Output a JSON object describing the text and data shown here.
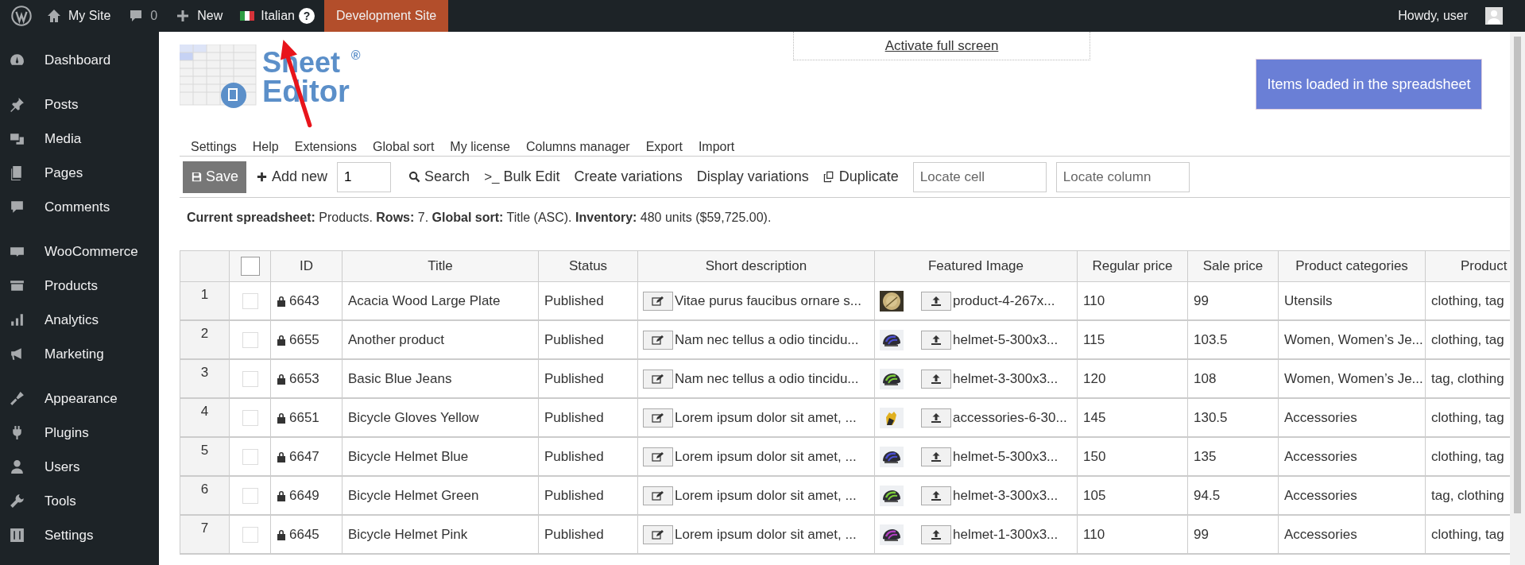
{
  "admin_bar": {
    "site": "My Site",
    "comments": "0",
    "new": "New",
    "language": "Italian",
    "help": "?",
    "environment": "Development Site",
    "greeting": "Howdy, user"
  },
  "sidebar": {
    "groups": [
      [
        {
          "label": "Dashboard"
        }
      ],
      [
        {
          "label": "Posts"
        },
        {
          "label": "Media"
        },
        {
          "label": "Pages"
        },
        {
          "label": "Comments"
        }
      ],
      [
        {
          "label": "WooCommerce"
        },
        {
          "label": "Products"
        },
        {
          "label": "Analytics"
        },
        {
          "label": "Marketing"
        }
      ],
      [
        {
          "label": "Appearance"
        },
        {
          "label": "Plugins"
        },
        {
          "label": "Users"
        },
        {
          "label": "Tools"
        },
        {
          "label": "Settings"
        }
      ]
    ]
  },
  "logo": {
    "word_1": "Sheet",
    "word_2": "Editor",
    "mark": "®"
  },
  "fullscreen_link": "Activate full screen",
  "items_button": "Items loaded in the spreadsheet",
  "menu": [
    "Settings",
    "Help",
    "Extensions",
    "Global sort",
    "My license",
    "Columns manager",
    "Export",
    "Import"
  ],
  "toolbar": {
    "save": "Save",
    "add_new": "Add new",
    "add_count": "1",
    "search": "Search",
    "bulk_edit_icon": ">_",
    "bulk_edit": "Bulk Edit",
    "create_variations": "Create variations",
    "display_variations": "Display variations",
    "duplicate": "Duplicate",
    "locate_cell": {
      "placeholder": "Locate cell"
    },
    "locate_column": {
      "placeholder": "Locate column"
    }
  },
  "summary": "**Current spreadsheet:** Products. **Rows:** 7. **Global sort:** Title (ASC). **Inventory:** 480 units ($59,725.00).",
  "table": {
    "select_all_checked": false,
    "columns": [
      "ID",
      "Title",
      "Status",
      "Short description",
      "Featured Image",
      "Regular price",
      "Sale price",
      "Product categories",
      "Product"
    ],
    "rows": [
      {
        "number": "1",
        "checked": false,
        "locked": true,
        "id": "6643",
        "title": "Acacia Wood Large Plate",
        "status": "Published",
        "short_description": "Vitae purus faucibus ornare s...",
        "file": "product-4-267x...",
        "regular_price": "110",
        "sale_price": "99",
        "categories": "Utensils",
        "product": "clothing, tag"
      },
      {
        "number": "2",
        "checked": false,
        "locked": true,
        "id": "6655",
        "title": "Another product",
        "status": "Published",
        "short_description": "Nam nec tellus a odio tincidu...",
        "file": "helmet-5-300x3...",
        "regular_price": "115",
        "sale_price": "103.5",
        "categories": "Women, Women’s Je...",
        "product": "clothing, tag"
      },
      {
        "number": "3",
        "checked": false,
        "locked": true,
        "id": "6653",
        "title": "Basic Blue Jeans",
        "status": "Published",
        "short_description": "Nam nec tellus a odio tincidu...",
        "file": "helmet-3-300x3...",
        "regular_price": "120",
        "sale_price": "108",
        "categories": "Women, Women’s Je...",
        "product": "tag, clothing"
      },
      {
        "number": "4",
        "checked": false,
        "locked": true,
        "id": "6651",
        "title": "Bicycle Gloves Yellow",
        "status": "Published",
        "short_description": "Lorem ipsum dolor sit amet, ...",
        "file": "accessories-6-30...",
        "regular_price": "145",
        "sale_price": "130.5",
        "categories": "Accessories",
        "product": "clothing, tag"
      },
      {
        "number": "5",
        "checked": false,
        "locked": true,
        "id": "6647",
        "title": "Bicycle Helmet Blue",
        "status": "Published",
        "short_description": "Lorem ipsum dolor sit amet, ...",
        "file": "helmet-5-300x3...",
        "regular_price": "150",
        "sale_price": "135",
        "categories": "Accessories",
        "product": "clothing, tag"
      },
      {
        "number": "6",
        "checked": false,
        "locked": true,
        "id": "6649",
        "title": "Bicycle Helmet Green",
        "status": "Published",
        "short_description": "Lorem ipsum dolor sit amet, ...",
        "file": "helmet-3-300x3...",
        "regular_price": "105",
        "sale_price": "94.5",
        "categories": "Accessories",
        "product": "tag, clothing"
      },
      {
        "number": "7",
        "checked": false,
        "locked": true,
        "id": "6645",
        "title": "Bicycle Helmet Pink",
        "status": "Published",
        "short_description": "Lorem ipsum dolor sit amet, ...",
        "file": "helmet-1-300x3...",
        "regular_price": "110",
        "sale_price": "99",
        "categories": "Accessories",
        "product": "clothing, tag"
      }
    ]
  },
  "annotations": [
    {
      "kind": "arrow"
    }
  ]
}
